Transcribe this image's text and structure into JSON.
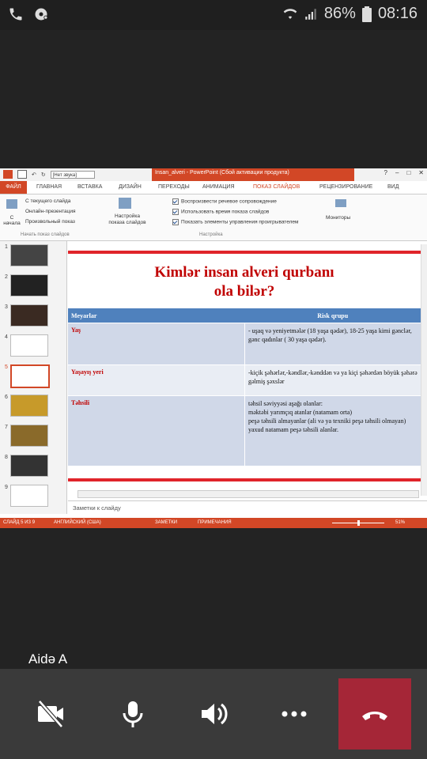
{
  "status_bar": {
    "battery": "86%",
    "time": "08:16"
  },
  "powerpoint": {
    "window_title": "Insan_alveri - PowerPoint (Сбой активации продукта)",
    "quick_access_combo": "[Нет звука]",
    "tabs": [
      "ФАЙЛ",
      "ГЛАВНАЯ",
      "ВСТАВКА",
      "ДИЗАЙН",
      "ПЕРЕХОДЫ",
      "АНИМАЦИЯ",
      "ПОКАЗ СЛАЙДОВ",
      "РЕЦЕНЗИРОВАНИЕ",
      "ВИД"
    ],
    "active_tab": "ПОКАЗ СЛАЙДОВ",
    "ribbon": {
      "from_start": "С начала",
      "from_current": "С текущего слайда",
      "online": "Онлайн-презентация",
      "custom": "Произвольный показ",
      "group1_label": "Начать показ слайдов",
      "setup": "Настройка показа слайдов",
      "record_narration": "Воспроизвести речевое сопровождение",
      "use_timings": "Использовать время показа слайдов",
      "show_controls": "Показать элементы управления проигрывателем",
      "group2_label": "Настройка",
      "monitors": "Мониторы"
    },
    "thumbnail_numbers": [
      "1",
      "2",
      "3",
      "4",
      "5",
      "6",
      "7",
      "8",
      "9"
    ],
    "selected_slide": 5,
    "slide": {
      "title_line1": "Kimlər insan alveri qurbanı",
      "title_line2": "ola bilər?",
      "table_headers": [
        "Meyarlar",
        "Risk qrupu"
      ],
      "rows": [
        {
          "criterion": "Yaş",
          "risk": "- uşaq və yeniyetmələr (18 yaşa qədər), 18-25 yaşa kimi gənclər, gənc qadınlar ( 30 yaşa qədər)."
        },
        {
          "criterion": "Yaşayış yeri",
          "risk": "-kiçik şəhərlər,-kəndlər,-kənddən və ya kiçi şəhərdən böyük şəhərə gəlmiş şəxslər"
        },
        {
          "criterion": "Təhsili",
          "risk_lines": [
            "təhsil səviyyəsi aşağı olanlar:",
            "məktəbi yarımçıq atanlar  (natamam orta)",
            "peşə təhsili almayanlar  (ali və ya texniki peşə təhsili olmayan) yaxud natamam peşə təhsili alanlar."
          ]
        }
      ]
    },
    "notes_placeholder": "Заметки к слайду",
    "statusbar": {
      "slide_info": "СЛАЙД 5 ИЗ 9",
      "language": "АНГЛИЙСКИЙ (США)",
      "notes": "ЗАМЕТКИ",
      "comments": "ПРИМЕЧАНИЯ",
      "zoom": "51%"
    }
  },
  "call": {
    "caller_name": "Aidə A"
  },
  "colors": {
    "ppt_accent": "#d24726",
    "hangup": "#a52637",
    "table_header": "#4f81bd"
  }
}
